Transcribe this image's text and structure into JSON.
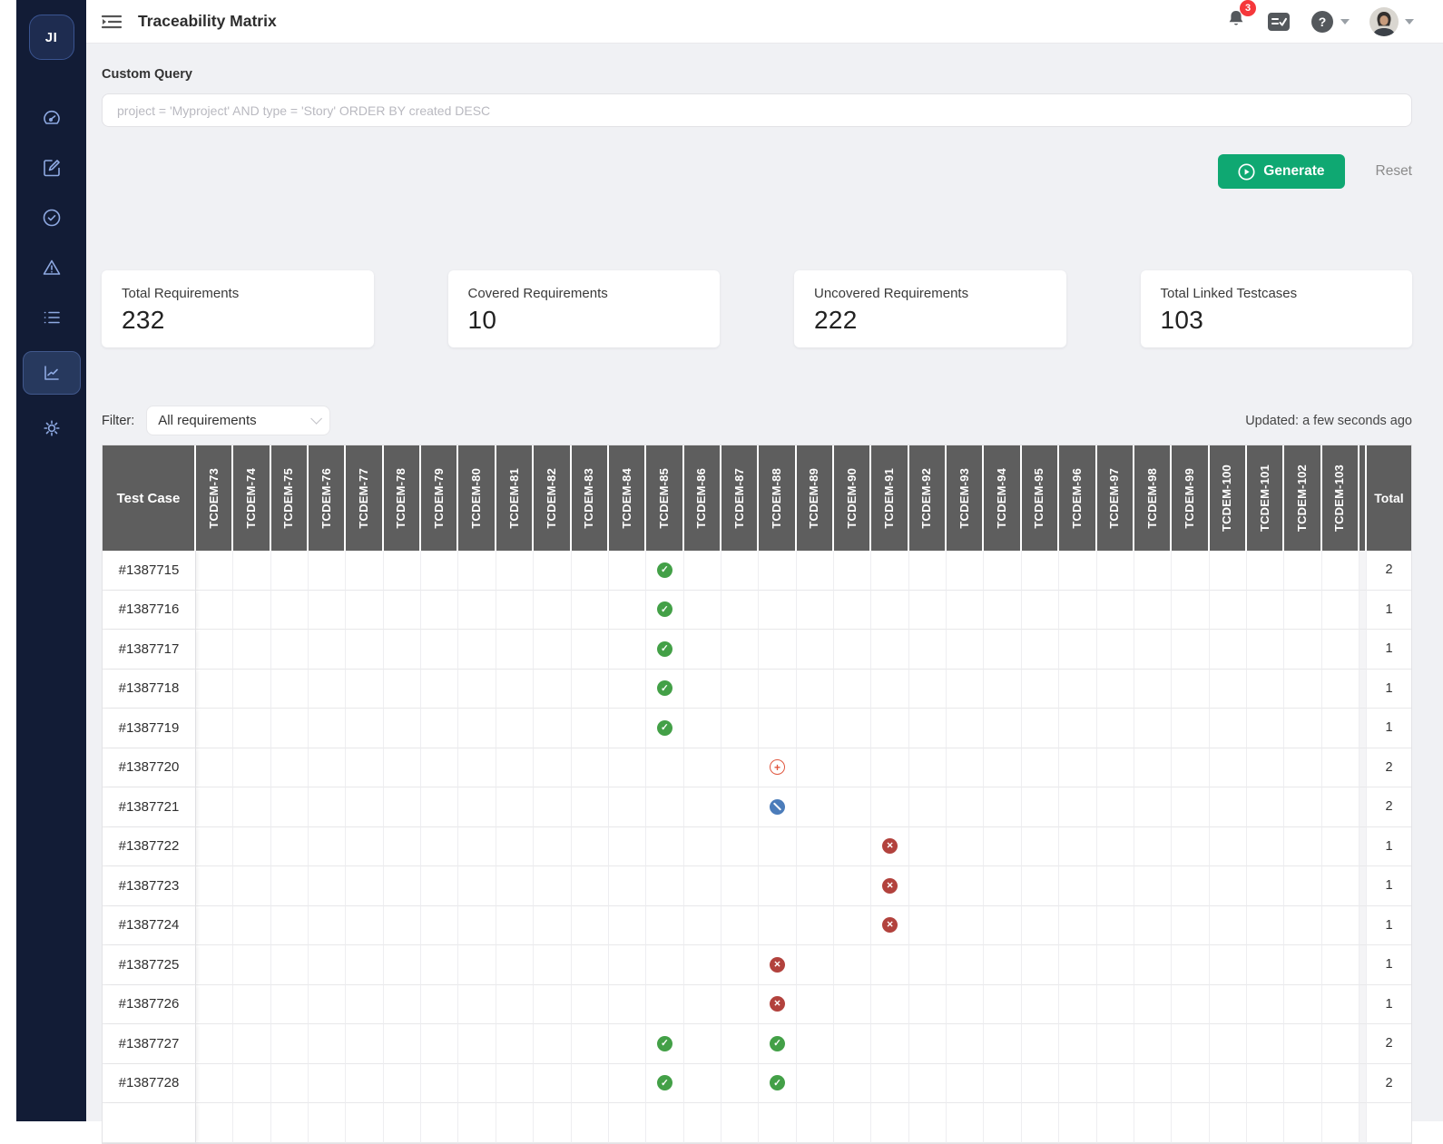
{
  "sidebar": {
    "logo_text": "JI",
    "items": [
      {
        "icon": "dashboard-icon",
        "active": false
      },
      {
        "icon": "edit-icon",
        "active": false
      },
      {
        "icon": "check-circle-icon",
        "active": false
      },
      {
        "icon": "warning-icon",
        "active": false
      },
      {
        "icon": "list-icon",
        "active": false
      },
      {
        "icon": "chart-icon",
        "active": true
      },
      {
        "icon": "gear-icon",
        "active": false
      }
    ]
  },
  "topbar": {
    "title": "Traceability Matrix",
    "notification_count": "3",
    "icons": [
      "menu-unfold-icon",
      "bell-icon",
      "test-runs-icon",
      "help-icon",
      "avatar"
    ]
  },
  "query": {
    "label": "Custom Query",
    "value": "",
    "placeholder": "project = 'Myproject' AND type = 'Story' ORDER BY created DESC"
  },
  "actions": {
    "generate": "Generate",
    "reset": "Reset"
  },
  "stats": [
    {
      "label": "Total Requirements",
      "value": "232"
    },
    {
      "label": "Covered Requirements",
      "value": "10"
    },
    {
      "label": "Uncovered Requirements",
      "value": "222"
    },
    {
      "label": "Total Linked Testcases",
      "value": "103"
    }
  ],
  "filter": {
    "label": "Filter:",
    "selected": "All requirements"
  },
  "updated": "Updated: a few seconds ago",
  "matrix": {
    "row_header": "Test Case",
    "total_header": "Total",
    "columns": [
      "TCDEM-73",
      "TCDEM-74",
      "TCDEM-75",
      "TCDEM-76",
      "TCDEM-77",
      "TCDEM-78",
      "TCDEM-79",
      "TCDEM-80",
      "TCDEM-81",
      "TCDEM-82",
      "TCDEM-83",
      "TCDEM-84",
      "TCDEM-85",
      "TCDEM-86",
      "TCDEM-87",
      "TCDEM-88",
      "TCDEM-89",
      "TCDEM-90",
      "TCDEM-91",
      "TCDEM-92",
      "TCDEM-93",
      "TCDEM-94",
      "TCDEM-95",
      "TCDEM-96",
      "TCDEM-97",
      "TCDEM-98",
      "TCDEM-99",
      "TCDEM-100",
      "TCDEM-101",
      "TCDEM-102",
      "TCDEM-103"
    ],
    "statuses": {
      "passed": {
        "color": "#43a047",
        "glyph": "check"
      },
      "failed": {
        "color": "#b2423d",
        "glyph": "cross"
      },
      "notrun": {
        "color": "#4b7cba",
        "glyph": "slash"
      },
      "inprogress": {
        "color": "#e0573f",
        "glyph": "plus"
      }
    },
    "rows": [
      {
        "id": "#1387715",
        "marks": {
          "TCDEM-85": "passed"
        },
        "total": "2"
      },
      {
        "id": "#1387716",
        "marks": {
          "TCDEM-85": "passed"
        },
        "total": "1"
      },
      {
        "id": "#1387717",
        "marks": {
          "TCDEM-85": "passed"
        },
        "total": "1"
      },
      {
        "id": "#1387718",
        "marks": {
          "TCDEM-85": "passed"
        },
        "total": "1"
      },
      {
        "id": "#1387719",
        "marks": {
          "TCDEM-85": "passed"
        },
        "total": "1"
      },
      {
        "id": "#1387720",
        "marks": {
          "TCDEM-88": "inprogress"
        },
        "total": "2"
      },
      {
        "id": "#1387721",
        "marks": {
          "TCDEM-88": "notrun"
        },
        "total": "2"
      },
      {
        "id": "#1387722",
        "marks": {
          "TCDEM-91": "failed"
        },
        "total": "1"
      },
      {
        "id": "#1387723",
        "marks": {
          "TCDEM-91": "failed"
        },
        "total": "1"
      },
      {
        "id": "#1387724",
        "marks": {
          "TCDEM-91": "failed"
        },
        "total": "1"
      },
      {
        "id": "#1387725",
        "marks": {
          "TCDEM-88": "failed"
        },
        "total": "1"
      },
      {
        "id": "#1387726",
        "marks": {
          "TCDEM-88": "failed"
        },
        "total": "1"
      },
      {
        "id": "#1387727",
        "marks": {
          "TCDEM-85": "passed",
          "TCDEM-88": "passed"
        },
        "total": "2"
      },
      {
        "id": "#1387728",
        "marks": {
          "TCDEM-85": "passed",
          "TCDEM-88": "passed"
        },
        "total": "2"
      }
    ]
  },
  "colors": {
    "accent_green": "#0fa872",
    "badge_red": "#f5383b",
    "header_gray": "#5e5e5e",
    "sidebar_navy": "#121c36",
    "sidebar_icon_blue": "#8ea9e2"
  }
}
